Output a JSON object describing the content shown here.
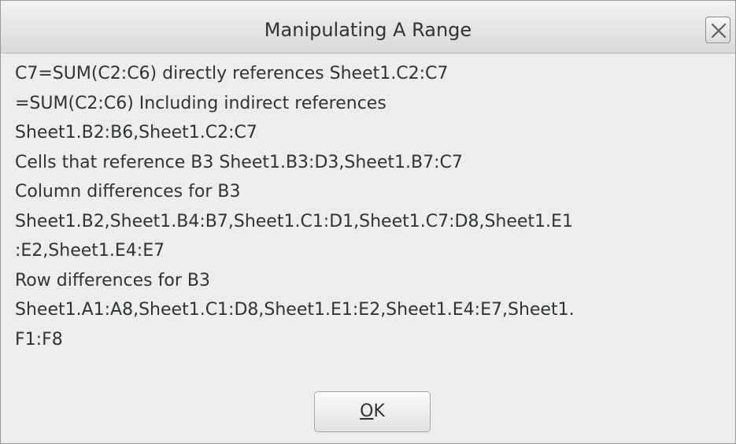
{
  "dialog": {
    "title": "Manipulating A Range",
    "close_icon": "close-icon",
    "lines": [
      "C7=SUM(C2:C6) directly references Sheet1.C2:C7",
      "=SUM(C2:C6) Including indirect references",
      "Sheet1.B2:B6,Sheet1.C2:C7",
      "Cells that reference B3 Sheet1.B3:D3,Sheet1.B7:C7",
      "Column differences for B3",
      "Sheet1.B2,Sheet1.B4:B7,Sheet1.C1:D1,Sheet1.C7:D8,Sheet1.E1",
      ":E2,Sheet1.E4:E7",
      "Row differences for B3",
      "Sheet1.A1:A8,Sheet1.C1:D8,Sheet1.E1:E2,Sheet1.E4:E7,Sheet1.",
      "F1:F8"
    ],
    "ok_button": {
      "mnemonic": "O",
      "rest": "K"
    }
  }
}
